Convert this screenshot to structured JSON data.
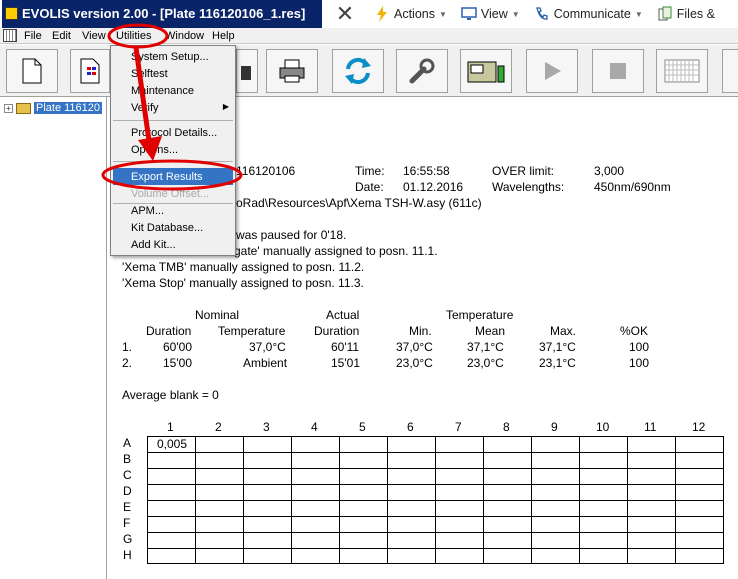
{
  "window": {
    "title": "EVOLIS version 2.00 - [Plate 116120106_1.res]"
  },
  "remote_toolbar": {
    "actions": "Actions",
    "view": "View",
    "communicate": "Communicate",
    "files": "Files &"
  },
  "menubar": {
    "file": "File",
    "edit": "Edit",
    "view": "View",
    "utilities": "Utilities",
    "window": "Window",
    "help": "Help"
  },
  "tree": {
    "item": "Plate 116120"
  },
  "utilities_menu": {
    "system_setup": "System Setup...",
    "selftest": "Selftest",
    "maintenance": "Maintenance",
    "verify": "Verify",
    "protocol_details": "Protocol Details...",
    "options": "Options...",
    "export_results": "Export Results",
    "volume_offset": "Volume Offset...",
    "apm": "APM...",
    "kit_database": "Kit Database...",
    "add_kit": "Add Kit..."
  },
  "report": {
    "plate_id": "116120106",
    "time_label": "Time:",
    "time_value": "16:55:58",
    "date_label": "Date:",
    "date_value": "01.12.2016",
    "over_limit_label": "OVER limit:",
    "over_limit_value": "3,000",
    "wavelengths_label": "Wavelengths:",
    "wavelengths_value": "450nm/690nm",
    "path": "oRad\\Resources\\Apf\\Xema TSH-W.asy (611c)",
    "paused": "was paused for 0'18.",
    "conjugate": "gate' manually assigned to posn. 11.1.",
    "tmb": "'Xema TMB' manually assigned to posn. 11.2.",
    "stop": "'Xema Stop' manually assigned to posn. 11.3.",
    "hdr_nominal": "Nominal",
    "hdr_actual": "Actual",
    "hdr_temperature": "Temperature",
    "hdr_duration": "Duration",
    "hdr_temperature2": "Temperature",
    "hdr_duration2": "Duration",
    "hdr_min": "Min.",
    "hdr_mean": "Mean",
    "hdr_max": "Max.",
    "hdr_ok": "%OK",
    "rows": [
      {
        "idx": "1.",
        "nom_dur": "60'00",
        "nom_temp": "37,0°C",
        "act_dur": "60'11",
        "min": "37,0°C",
        "mean": "37,1°C",
        "max": "37,1°C",
        "ok": "100"
      },
      {
        "idx": "2.",
        "nom_dur": "15'00",
        "nom_temp": "Ambient",
        "act_dur": "15'01",
        "min": "23,0°C",
        "mean": "23,0°C",
        "max": "23,1°C",
        "ok": "100"
      }
    ],
    "average_blank": "Average blank = 0"
  },
  "plate": {
    "columns": [
      "1",
      "2",
      "3",
      "4",
      "5",
      "6",
      "7",
      "8",
      "9",
      "10",
      "11",
      "12"
    ],
    "rows": [
      "A",
      "B",
      "C",
      "D",
      "E",
      "F",
      "G",
      "H"
    ],
    "a1": "0,005"
  },
  "colors": {
    "title_bar": "#0a246a",
    "highlight": "#3574c4",
    "annotation": "#e00000"
  }
}
